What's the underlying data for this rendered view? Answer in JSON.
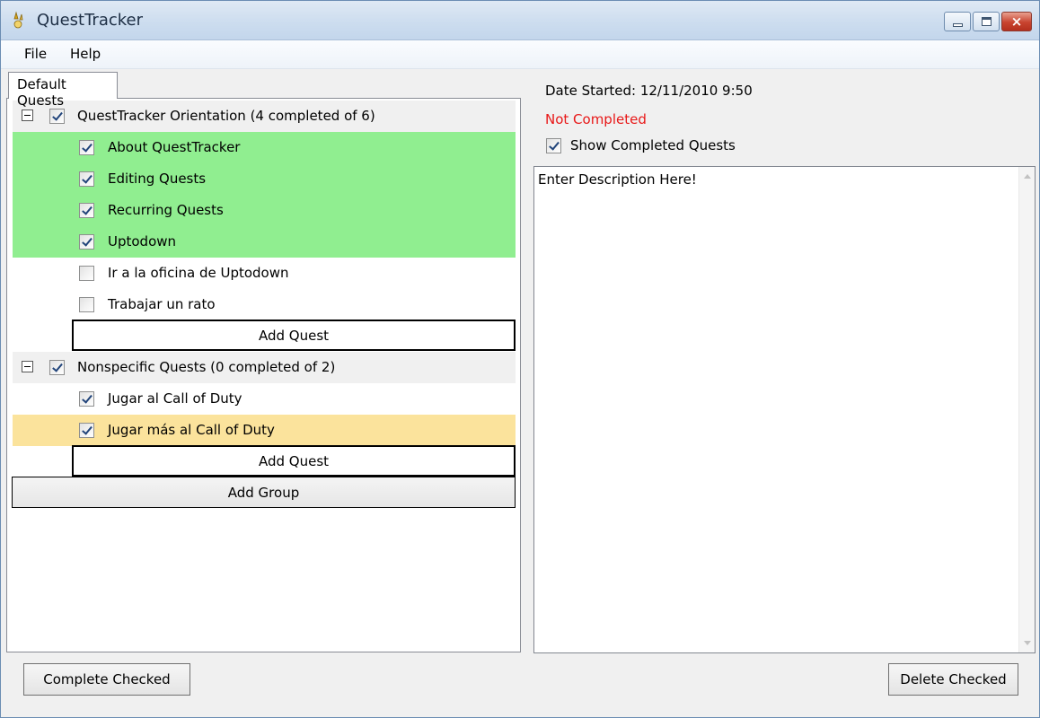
{
  "window": {
    "title": "QuestTracker",
    "close_glyph": "×",
    "accent_color": "#c3d6ec"
  },
  "menu": {
    "items": [
      {
        "label": "File"
      },
      {
        "label": "Help"
      }
    ]
  },
  "tabs": [
    {
      "label": "Default Quests"
    }
  ],
  "groups": [
    {
      "label": "QuestTracker Orientation (4 completed of 6)",
      "checked": true,
      "quests": [
        {
          "label": "About QuestTracker",
          "checked": true,
          "state": "done"
        },
        {
          "label": "Editing Quests",
          "checked": true,
          "state": "done"
        },
        {
          "label": "Recurring Quests",
          "checked": true,
          "state": "done"
        },
        {
          "label": "Uptodown",
          "checked": true,
          "state": "done"
        },
        {
          "label": "Ir a la oficina de Uptodown",
          "checked": false,
          "state": "normal"
        },
        {
          "label": "Trabajar un rato",
          "checked": false,
          "state": "normal"
        }
      ],
      "add_quest_label": "Add Quest"
    },
    {
      "label": "Nonspecific Quests (0 completed of 2)",
      "checked": true,
      "quests": [
        {
          "label": "Jugar al Call of Duty",
          "checked": true,
          "state": "normal"
        },
        {
          "label": "Jugar más al Call of Duty",
          "checked": true,
          "state": "selected"
        }
      ],
      "add_quest_label": "Add Quest"
    }
  ],
  "add_group_label": "Add Group",
  "details": {
    "date_started": "Date Started: 12/11/2010 9:50",
    "status": "Not Completed",
    "status_color": "#e81818",
    "show_completed_label": "Show Completed Quests",
    "show_completed_checked": true,
    "description": "Enter Description Here!"
  },
  "colors": {
    "done": "#90ee90",
    "selected": "#fbe39c"
  },
  "footer": {
    "complete_checked_label": "Complete Checked",
    "delete_checked_label": "Delete Checked"
  }
}
